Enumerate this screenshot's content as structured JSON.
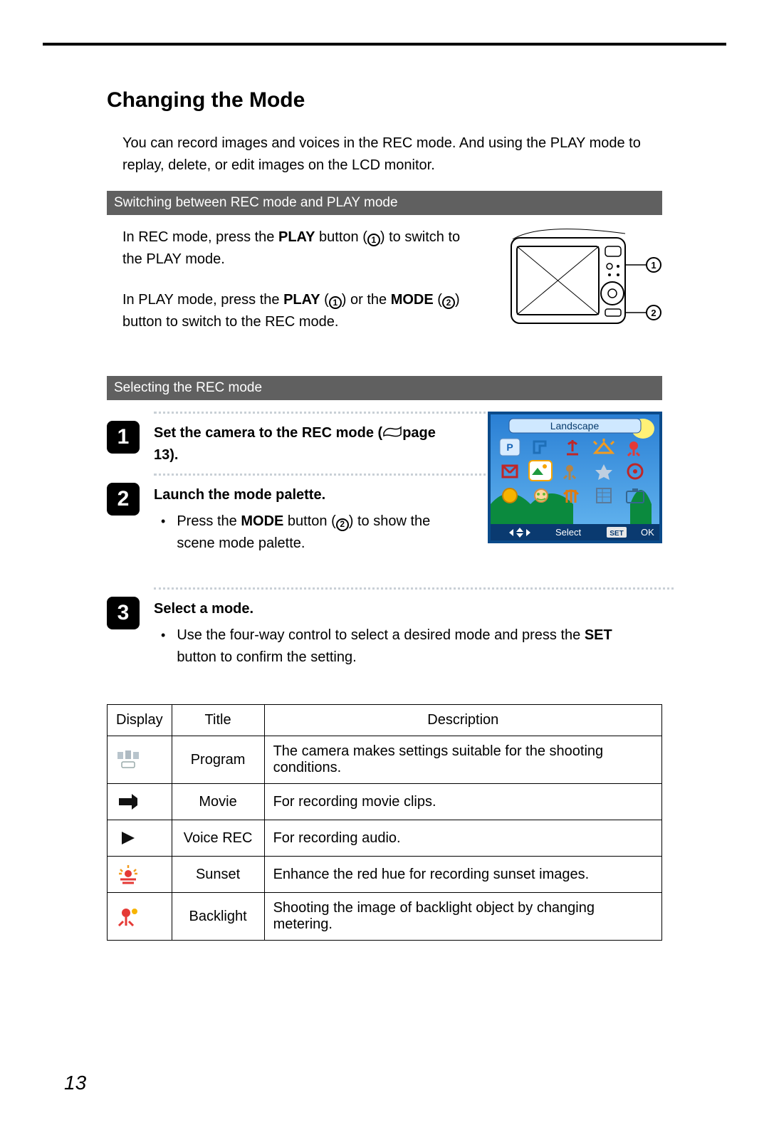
{
  "title": "Changing the Mode",
  "intro": "You can record images and voices in the REC mode. And using the PLAY mode to replay, delete, or edit images on the LCD monitor.",
  "section1": {
    "header": "Switching between REC mode and PLAY mode",
    "p1_a": "In REC mode, press the ",
    "p1_b": "PLAY",
    "p1_c": " button (",
    "p1_d": ") to switch to the PLAY mode.",
    "p2_a": "In PLAY mode, press the ",
    "p2_b": "PLAY",
    "p2_c": " (",
    "p2_d": ") or the ",
    "p2_e": "MODE",
    "p2_f": " (",
    "p2_g": ") button to switch to the REC mode.",
    "callouts": {
      "a": "1",
      "b": "2"
    }
  },
  "section2": {
    "header": "Selecting the REC mode",
    "palette_title": "Landscape",
    "palette_left": "Select",
    "palette_right": "OK",
    "palette_set": "SET",
    "steps": [
      {
        "num": "1",
        "head_a": "Set the camera to the REC mode (",
        "head_b": "page 13)."
      },
      {
        "num": "2",
        "head": "Launch the mode palette.",
        "bullet_a": "Press the ",
        "bullet_b": "MODE",
        "bullet_c": " button (",
        "bullet_d": ") to show the scene mode palette."
      },
      {
        "num": "3",
        "head": "Select a mode.",
        "bullet_a": "Use the four-way control to select a desired mode and press the ",
        "bullet_b": "SET",
        "bullet_c": " button to confirm the setting."
      }
    ]
  },
  "table": {
    "headers": {
      "display": "Display",
      "title": "Title",
      "description": "Description"
    },
    "rows": [
      {
        "icon": "program",
        "title": "Program",
        "desc": "The camera makes settings suitable for the shooting conditions."
      },
      {
        "icon": "movie",
        "title": "Movie",
        "desc": "For recording movie clips."
      },
      {
        "icon": "voice",
        "title": "Voice REC",
        "desc": "For recording audio."
      },
      {
        "icon": "sunset",
        "title": "Sunset",
        "desc": "Enhance the red hue for recording sunset images."
      },
      {
        "icon": "backlight",
        "title": "Backlight",
        "desc": "Shooting the image of backlight object by changing metering."
      }
    ]
  },
  "page_number": "13"
}
